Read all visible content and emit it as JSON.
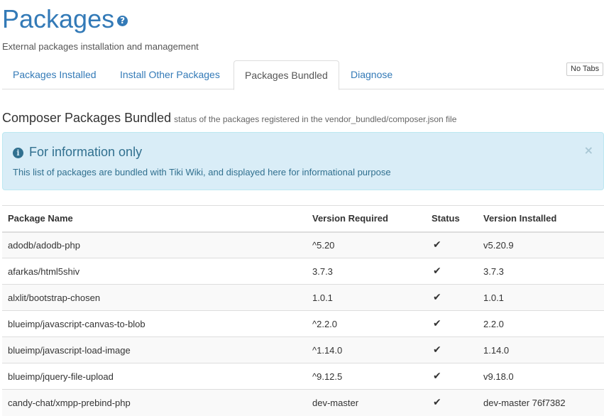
{
  "page": {
    "title": "Packages",
    "help_icon": "?",
    "subtitle": "External packages installation and management"
  },
  "tabs": [
    {
      "label": "Packages Installed",
      "active": false
    },
    {
      "label": "Install Other Packages",
      "active": false
    },
    {
      "label": "Packages Bundled",
      "active": true
    },
    {
      "label": "Diagnose",
      "active": false
    }
  ],
  "no_tabs_label": "No Tabs",
  "section": {
    "heading": "Composer Packages Bundled",
    "subheading": "status of the packages registered in the vendor_bundled/composer.json file"
  },
  "alert": {
    "icon": "info-circle-icon",
    "title": "For information only",
    "text": "This list of packages are bundled with Tiki Wiki, and displayed here for informational purpose",
    "close": "×"
  },
  "table": {
    "headers": [
      "Package Name",
      "Version Required",
      "Status",
      "Version Installed"
    ],
    "status_icon": "check-icon",
    "rows": [
      {
        "name": "adodb/adodb-php",
        "required": "^5.20",
        "status": "✔",
        "installed": "v5.20.9"
      },
      {
        "name": "afarkas/html5shiv",
        "required": "3.7.3",
        "status": "✔",
        "installed": "3.7.3"
      },
      {
        "name": "alxlit/bootstrap-chosen",
        "required": "1.0.1",
        "status": "✔",
        "installed": "1.0.1"
      },
      {
        "name": "blueimp/javascript-canvas-to-blob",
        "required": "^2.2.0",
        "status": "✔",
        "installed": "2.2.0"
      },
      {
        "name": "blueimp/javascript-load-image",
        "required": "^1.14.0",
        "status": "✔",
        "installed": "1.14.0"
      },
      {
        "name": "blueimp/jquery-file-upload",
        "required": "^9.12.5",
        "status": "✔",
        "installed": "v9.18.0"
      },
      {
        "name": "candy-chat/xmpp-prebind-php",
        "required": "dev-master",
        "status": "✔",
        "installed": "dev-master 76f7382"
      }
    ]
  },
  "colors": {
    "link": "#337ab7",
    "alert_bg": "#d9edf7",
    "alert_text": "#31708f"
  }
}
